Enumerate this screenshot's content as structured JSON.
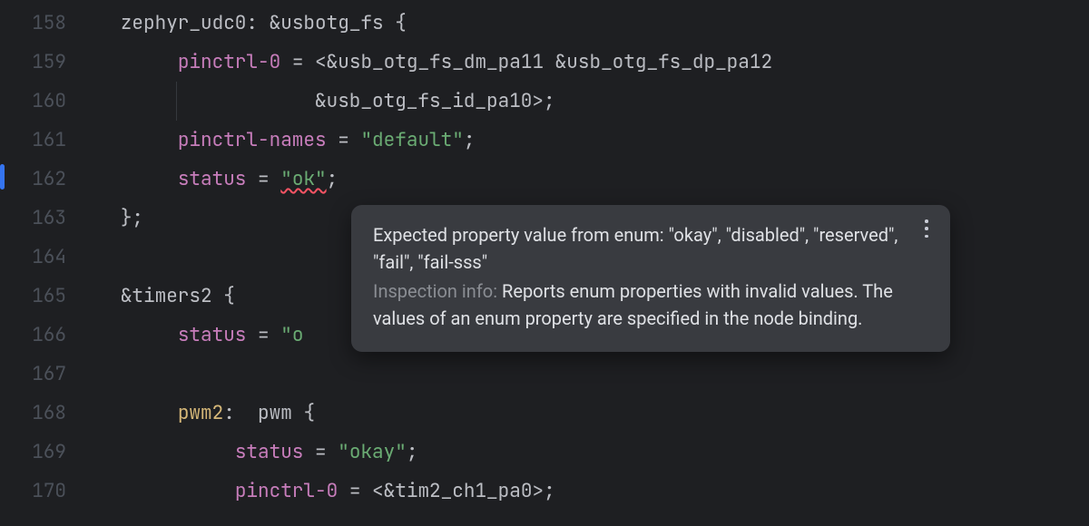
{
  "line_numbers": [
    "158",
    "159",
    "160",
    "161",
    "162",
    "163",
    "164",
    "165",
    "166",
    "167",
    "168",
    "169",
    "170"
  ],
  "caret_line_index": 4,
  "code": {
    "l158": {
      "label": "zephyr_udc0",
      "ref": "&usbotg_fs",
      "open": "{"
    },
    "l159": {
      "prop": "pinctrl-0",
      "eq": "=",
      "lt": "<",
      "ref1": "&usb_otg_fs_dm_pa11",
      "ref2": "&usb_otg_fs_dp_pa12"
    },
    "l160": {
      "ref3": "&usb_otg_fs_id_pa10",
      "gt_semi": ">;"
    },
    "l161": {
      "prop": "pinctrl-names",
      "eq": "=",
      "val": "\"default\"",
      "semi": ";"
    },
    "l162": {
      "prop": "status",
      "eq": "=",
      "val": "\"ok\"",
      "semi": ";"
    },
    "l163": {
      "close": "};"
    },
    "l165": {
      "ref": "&timers2",
      "open": "{"
    },
    "l166": {
      "prop": "status",
      "eq": "=",
      "val_partial": "\"o"
    },
    "l168": {
      "label": "pwm2",
      "node": "pwm",
      "open": "{"
    },
    "l169": {
      "prop": "status",
      "eq": "=",
      "val": "\"okay\"",
      "semi": ";"
    },
    "l170": {
      "prop": "pinctrl-0",
      "eq": "=",
      "lt": "<",
      "ref": "&tim2_ch1_pa0",
      "gt_semi": ">;"
    }
  },
  "tooltip": {
    "message": "Expected property value from enum: \"okay\", \"disabled\", \"reserved\", \"fail\", \"fail-sss\"",
    "info_label": "Inspection info: ",
    "info_body": "Reports enum properties with invalid values. The values of an enum property are specified in the node binding."
  }
}
